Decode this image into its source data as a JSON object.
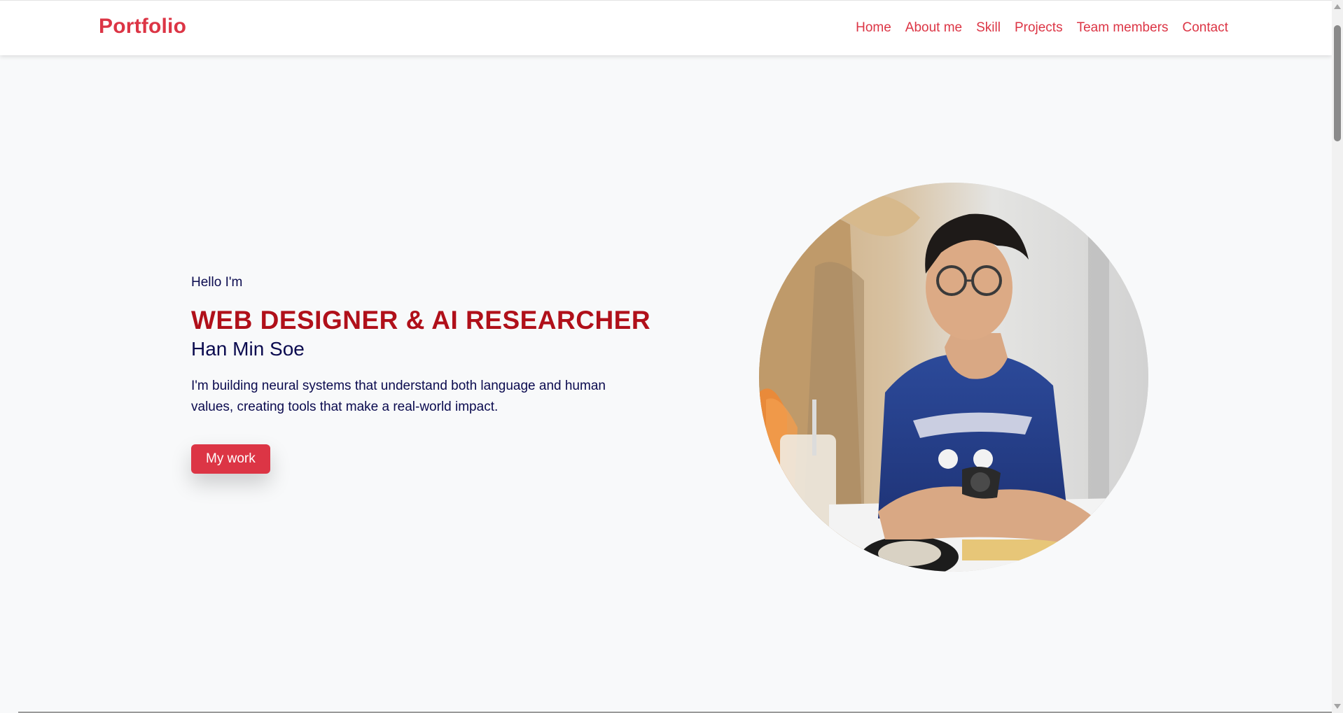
{
  "navbar": {
    "brand": "Portfolio",
    "links": [
      "Home",
      "About me",
      "Skill",
      "Projects",
      "Team members",
      "Contact"
    ]
  },
  "hero": {
    "greeting": "Hello I'm",
    "role": "WEB DESIGNER & AI RESEARCHER",
    "name": "Han Min Soe",
    "description": "I'm building neural systems that understand both language and human values, creating tools that make a real-world impact.",
    "button_label": "My work"
  },
  "colors": {
    "accent": "#dc3545",
    "heading_red": "#b0101a",
    "text_navy": "#0b0b4f",
    "background": "#f8f9fa"
  }
}
